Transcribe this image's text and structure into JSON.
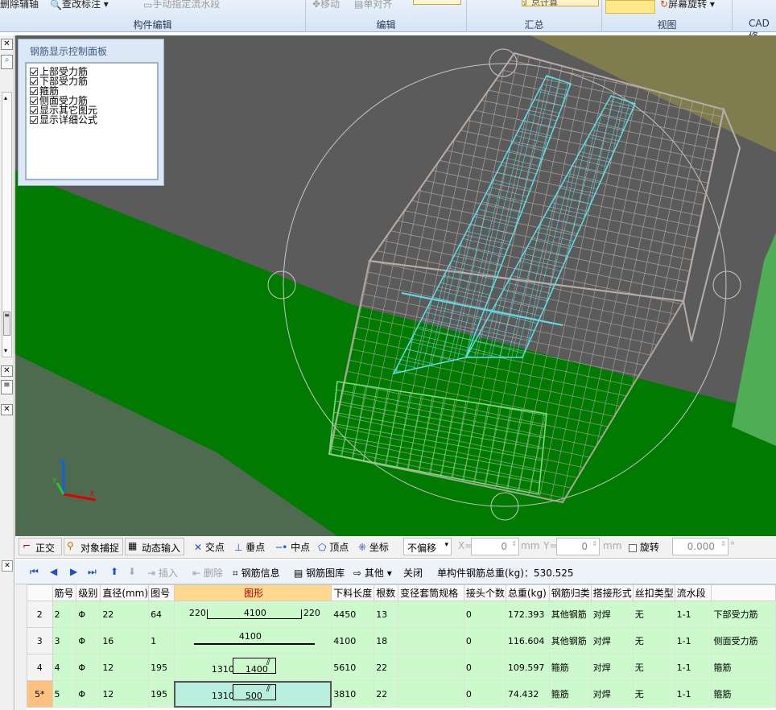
{
  "ribbon": {
    "groups": [
      {
        "label": "构件编辑",
        "buttons": [
          "删除辅轴",
          "查改标注",
          "手动指定流水段"
        ]
      },
      {
        "label": "编辑",
        "buttons": [
          "移动",
          "单对齐"
        ]
      },
      {
        "label": "汇总",
        "buttons": [
          "汇总计算"
        ]
      },
      {
        "label": "视图",
        "buttons": [
          "屏幕旋转"
        ]
      },
      {
        "label": "CAD修",
        "buttons": []
      }
    ]
  },
  "rebar_panel": {
    "title": "钢筋显示控制面板",
    "items": [
      "上部受力筋",
      "下部受力筋",
      "箍筋",
      "侧面受力筋",
      "显示其它图元",
      "显示详细公式"
    ]
  },
  "snap_toolbar": {
    "ortho": "正交",
    "object_snap": "对象捕捉",
    "dynamic_input": "动态输入",
    "intersection": "交点",
    "perpendicular": "垂点",
    "midpoint": "中点",
    "vertex": "顶点",
    "coordinate": "坐标",
    "offset_mode": "不偏移",
    "x_label": "X=",
    "x_value": "0",
    "unit": "mm",
    "y_label": "Y=",
    "y_value": "0",
    "rotate_label": "旋转",
    "rotate_value": "0.000",
    "degree": "°"
  },
  "rebar_toolbar": {
    "insert": "插入",
    "delete": "删除",
    "rebar_info": "钢筋信息",
    "rebar_library": "钢筋图库",
    "other": "其他",
    "close": "关闭",
    "total_weight": "单构件钢筋总重(kg)：530.525"
  },
  "table": {
    "headers": [
      "筋号",
      "级别",
      "直径(mm)",
      "图号",
      "图形",
      "下料长度",
      "根数",
      "变径套筒规格",
      "接头个数",
      "总重(kg)",
      "钢筋归类",
      "搭接形式",
      "丝扣类型",
      "流水段",
      ""
    ],
    "rows": [
      {
        "row": "2",
        "no": "2",
        "grade": "Φ",
        "dia": "22",
        "fig": "64",
        "shape": {
          "left": "220",
          "mid": "4100",
          "right": "220"
        },
        "length": "4450",
        "count": "13",
        "sleeve": "",
        "joints": "0",
        "weight": "172.393",
        "category": "其他钢筋",
        "lap": "对焊",
        "thread": "无",
        "segment": "1-1",
        "name": "下部受力筋"
      },
      {
        "row": "3",
        "no": "3",
        "grade": "Φ",
        "dia": "16",
        "fig": "1",
        "shape": {
          "left": "",
          "mid": "4100",
          "right": ""
        },
        "length": "4100",
        "count": "18",
        "sleeve": "",
        "joints": "0",
        "weight": "116.604",
        "category": "其他钢筋",
        "lap": "对焊",
        "thread": "无",
        "segment": "1-1",
        "name": "侧面受力筋"
      },
      {
        "row": "4",
        "no": "4",
        "grade": "Φ",
        "dia": "12",
        "fig": "195",
        "shape": {
          "left": "1310",
          "mid": "1400",
          "right": ""
        },
        "length": "5610",
        "count": "22",
        "sleeve": "",
        "joints": "0",
        "weight": "109.597",
        "category": "箍筋",
        "lap": "对焊",
        "thread": "无",
        "segment": "1-1",
        "name": "箍筋"
      },
      {
        "row": "5*",
        "no": "5",
        "grade": "Φ",
        "dia": "12",
        "fig": "195",
        "shape": {
          "left": "1310",
          "mid": "500",
          "right": ""
        },
        "length": "3810",
        "count": "22",
        "sleeve": "",
        "joints": "0",
        "weight": "74.432",
        "category": "箍筋",
        "lap": "对焊",
        "thread": "无",
        "segment": "1-1",
        "name": "箍筋"
      }
    ]
  },
  "colors": {
    "ground": "#007a00",
    "rebar_cyan": "#5fe0e8",
    "rebar_gray": "#b8aca6",
    "selected_row": "#ffc080"
  }
}
